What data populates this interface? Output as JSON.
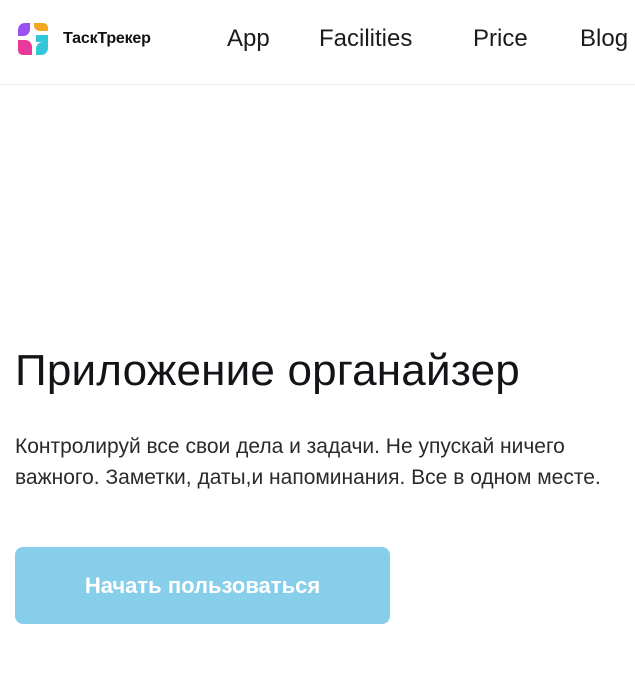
{
  "header": {
    "brand_name": "ТаскТрекер",
    "logo_icon": "tasktracker-logo-icon",
    "nav": [
      {
        "label": "App"
      },
      {
        "label": "Facilities"
      },
      {
        "label": "Price"
      },
      {
        "label": "Blog"
      }
    ]
  },
  "hero": {
    "title": "Приложение органайзер",
    "description": "Контролируй все свои дела и задачи. Не упускай ничего важного. Заметки, даты,и напоминания. Все в одном месте.",
    "cta_label": "Начать пользоваться"
  },
  "colors": {
    "cta_background": "#87ceea",
    "cta_text": "#ffffff",
    "logo_pink": "#e93a9a",
    "logo_purple": "#9b4ff0",
    "logo_orange": "#f5a623",
    "logo_cyan": "#31c6d8"
  }
}
